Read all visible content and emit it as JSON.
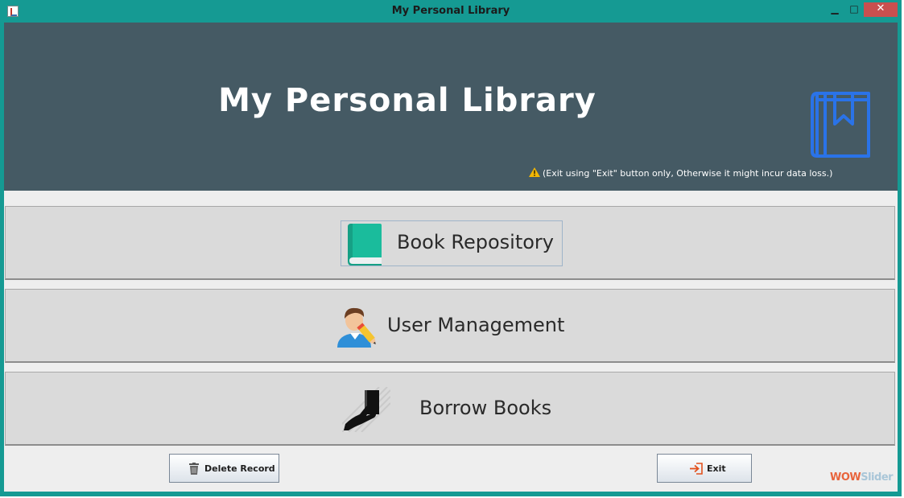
{
  "window": {
    "title": "My Personal Library",
    "controls": {
      "minimize": "▁",
      "maximize": "□",
      "close": "✕"
    }
  },
  "header": {
    "title": "My Personal Library",
    "warning": "(Exit using \"Exit\" button only, Otherwise it might incur data loss.)",
    "logo_icon": "bookmark-book-icon"
  },
  "menu": [
    {
      "label": "Book Repository",
      "icon": "book-icon"
    },
    {
      "label": "User Management",
      "icon": "user-edit-icon"
    },
    {
      "label": "Borrow Books",
      "icon": "hand-book-icon"
    }
  ],
  "footer": {
    "delete_label": "Delete Record",
    "delete_icon": "trash-icon",
    "exit_label": "Exit",
    "exit_icon": "exit-icon"
  },
  "watermark": {
    "part1": "WOW",
    "part2": "Slider"
  },
  "colors": {
    "frame": "#159a93",
    "header": "#455a64",
    "accent_blue": "#2a73e8",
    "book_teal": "#1abc9c",
    "close_button": "#c94f4f"
  }
}
